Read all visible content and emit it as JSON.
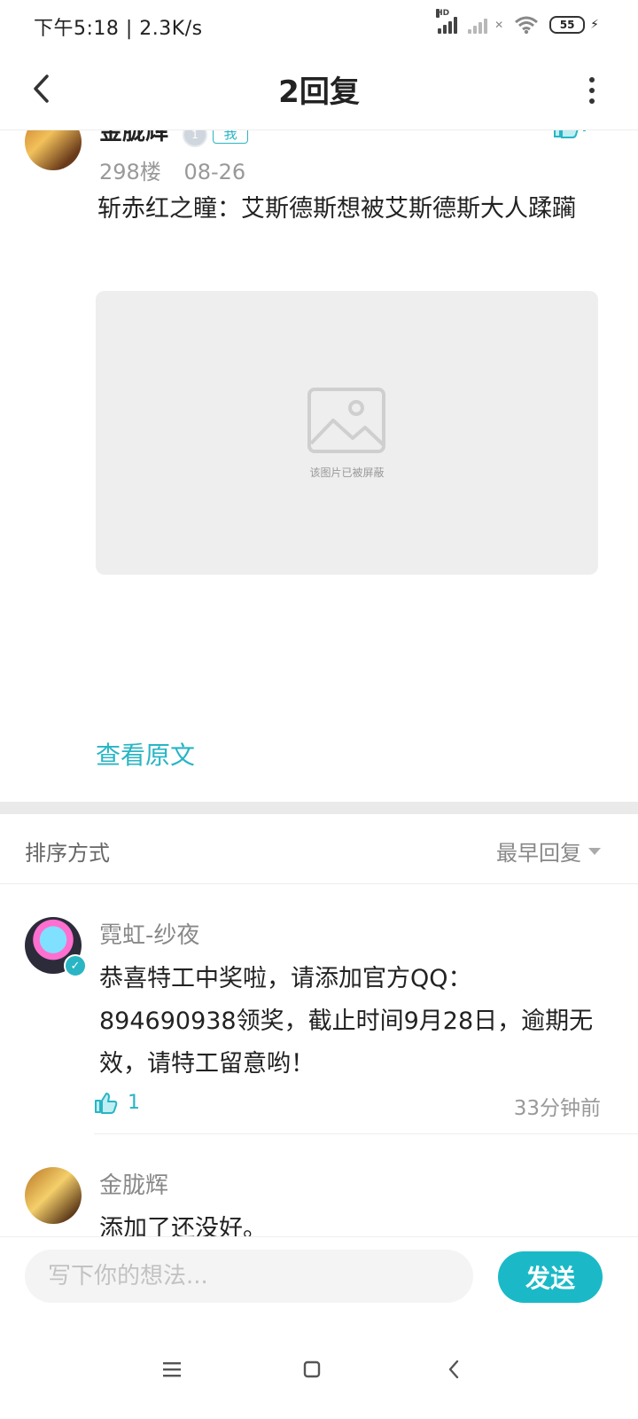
{
  "status": {
    "time_speed": "下午5:18 | 2.3K/s",
    "battery": "55",
    "hd_label": "HD"
  },
  "header": {
    "title": "2回复"
  },
  "post": {
    "author": "金胧辉",
    "tag": "我",
    "floor": "298楼",
    "date": "08-26",
    "text": "斩赤红之瞳：艾斯德斯想被艾斯德斯大人蹂躏",
    "image_caption": "该图片已被屏蔽",
    "view_original": "查看原文"
  },
  "sort": {
    "label": "排序方式",
    "value": "最早回复"
  },
  "replies": [
    {
      "author": "霓虹-纱夜",
      "text": "恭喜特工中奖啦，请添加官方QQ：894690938领奖，截止时间9月28日，逾期无效，请特工留意哟！",
      "likes": "1",
      "time": "33分钟前"
    },
    {
      "author": "金胧辉",
      "text": "添加了还没好。"
    }
  ],
  "composer": {
    "placeholder": "写下你的想法...",
    "send_label": "发送"
  },
  "colors": {
    "accent": "#29b5c4",
    "send_button": "#1bb9c7"
  }
}
